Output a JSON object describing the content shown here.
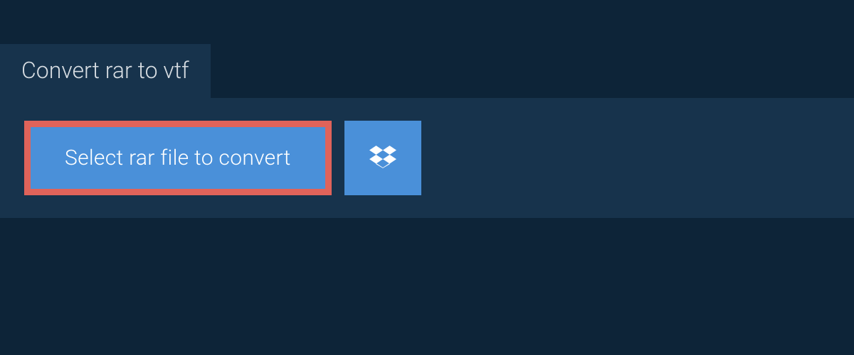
{
  "tab": {
    "title": "Convert rar to vtf"
  },
  "actions": {
    "select_file_label": "Select rar file to convert",
    "dropbox_icon": "dropbox"
  },
  "colors": {
    "background": "#0d2438",
    "panel": "#17334c",
    "button": "#4a90d9",
    "highlight_border": "#e0635a",
    "text_light": "#d7dde2",
    "text_white": "#ffffff"
  }
}
